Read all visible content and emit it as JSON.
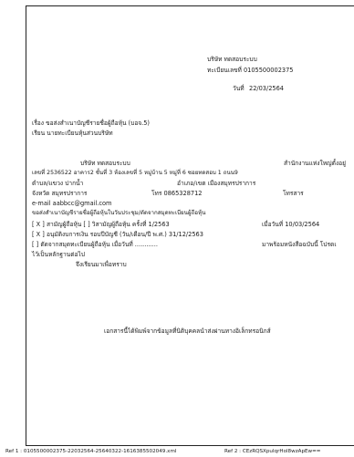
{
  "header": {
    "company_line": "บริษัท   ทดสอบระบบ",
    "registration_line": "ทะเบียนเลขที่   0105500002375",
    "date_label": "วันที่",
    "date_value": "22/03/2564"
  },
  "subject": {
    "subject_line": "เรื่อง  ขอส่งสำเนาบัญชีรายชื่อผู้ถือหุ้น  (บอจ.5)",
    "to_line": "เรียน  นายทะเบียนหุ้นส่วนบริษัท"
  },
  "body": {
    "company_intro": "บริษัท    ทดสอบระบบ",
    "office_line": "สำนักงานแห่งใหญ่ตั้งอยู่",
    "address_line": "เลขที่   2536522  อาคาร2 ชั้นที่ 3  ห้องเลขที่ 5 หมู่บ้าน 5 หมู่ที่ 6 ซอยทดสอบ 1 ถนน9",
    "subdistrict_line": "ตำบล/แขวง   ปากน้ำ",
    "district_line": "อำเภอ/เขต   เมืองสมุทรปราการ",
    "province_line": "จังหวัด  สมุทรปราการ",
    "phone_line": "โทร   0865328712",
    "fax_label": "โทรสาร",
    "email_line": "e-mail  aabbcc@gmail.com",
    "purpose_line": "ขอส่งสำเนาบัญชีรายชื่อผู้ถือหุ้นในวันประชุม/ตัดจากสมุดทะเบียนผู้ถือหุ้น",
    "option1_line": "[ X ]  สามัญผู้ถือหุ้น   [  ]  วิสามัญผู้ถือหุ้น  ครั้งที่  1/2563",
    "option1_date": "เมื่อวันที่  10/03/2564",
    "option2_line": "[ X ]  อนุมัติงบการเงิน รอบปีบัญชี (วัน/เดือน/ปี พ.ศ.)    31/12/2563",
    "option3_line": "[   ]   ตัดจากสมุดทะเบียนผู้ถือหุ้น เมื่อวันที่     ............",
    "option3_tail": "มาพร้อมหนังสือฉบับนี้ โปรดเ",
    "evidence_line": "ไว้เป็นหลักฐานต่อไป",
    "closing_line": "จึงเรียนมาเพื่อทราบ"
  },
  "footer": {
    "electronic_note": "เอกสารนี้ได้พิมพ์จากข้อมูลที่นิติบุคคลนำส่งผ่านทางอิเล็กทรอนิกส์",
    "ref1": "Ref 1 :  0105500002375-22032564-25640322-1616385502049.xml",
    "ref2": "Ref 2 :  CEzRQSXpulqrHol8wzApEw=="
  }
}
